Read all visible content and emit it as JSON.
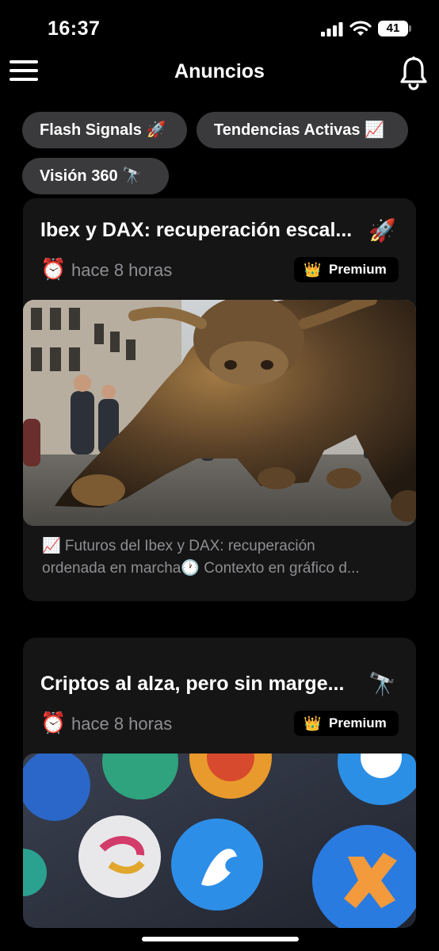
{
  "status": {
    "time": "16:37",
    "battery": "41"
  },
  "header": {
    "title": "Anuncios"
  },
  "chips": [
    {
      "label": "Flash Signals 🚀"
    },
    {
      "label": "Tendencias Activas 📈"
    },
    {
      "label": "Visión 360 🔭"
    }
  ],
  "cards": [
    {
      "title": "Ibex y DAX: recuperación escal...",
      "title_emoji": "🚀",
      "time_icon": "⏰",
      "time": "hace 8 horas",
      "badge_icon": "👑",
      "badge": "Premium",
      "image": "bronze-bull-statue-wall-street",
      "desc_line1": "📈 Futuros del Ibex y DAX: recuperación",
      "desc_line2": "ordenada en marcha🕐 Contexto en gráfico d..."
    },
    {
      "title": "Criptos al alza, pero sin marge...",
      "title_emoji": "🔭",
      "time_icon": "⏰",
      "time": "hace 8 horas",
      "badge_icon": "👑",
      "badge": "Premium",
      "image": "crypto-coin-icons"
    }
  ],
  "colors": {
    "background": "#000000",
    "card": "#151515",
    "chip": "#3a3a3c",
    "muted": "#8e8e93"
  }
}
